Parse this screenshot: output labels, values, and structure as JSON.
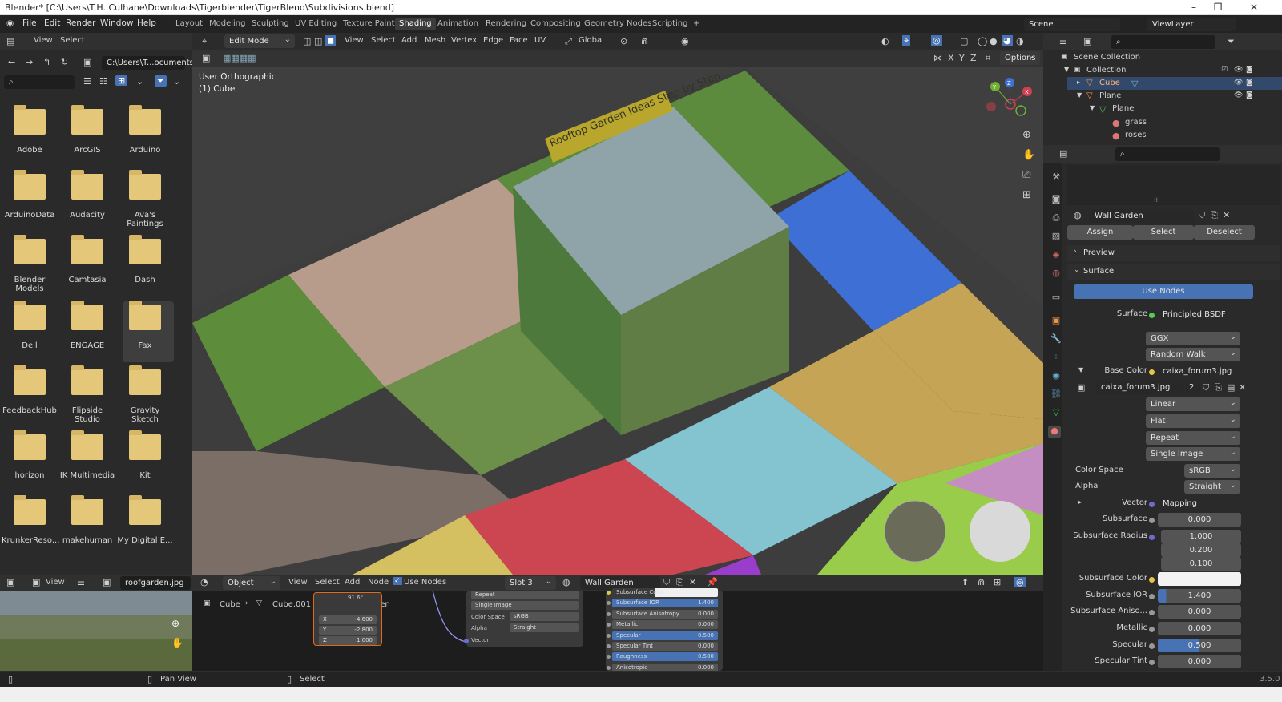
{
  "window": {
    "title": "Blender* [C:\\Users\\T.H. Culhane\\Downloads\\Tigerblender\\TigerBlend\\Subdivisions.blend]",
    "minimize": "–",
    "restore": "❐",
    "close": "✕"
  },
  "menu": [
    "File",
    "Edit",
    "Render",
    "Window",
    "Help"
  ],
  "workspaces": [
    "Layout",
    "Modeling",
    "Sculpting",
    "UV Editing",
    "Texture Paint",
    "Shading",
    "Animation",
    "Rendering",
    "Compositing",
    "Geometry Nodes",
    "Scripting",
    "+"
  ],
  "scene": {
    "label": "Scene",
    "viewlayer": "ViewLayer"
  },
  "filebrowser": {
    "view": "View",
    "select": "Select",
    "path": "C:\\Users\\T...ocuments\\",
    "items": [
      "Adobe",
      "ArcGIS",
      "Arduino",
      "ArduinoData",
      "Audacity",
      "Ava's Paintings",
      "Blender Models",
      "Camtasia",
      "Dash",
      "Dell",
      "ENGAGE",
      "Fax",
      "FeedbackHub",
      "Flipside Studio",
      "Gravity Sketch",
      "horizon",
      "IK Multimedia",
      "Kit",
      "KrunkerReso...",
      "makehuman",
      "My Digital E..."
    ]
  },
  "viewport": {
    "mode": "Edit Mode",
    "menus": [
      "View",
      "Select",
      "Add",
      "Mesh",
      "Vertex",
      "Edge",
      "Face",
      "UV"
    ],
    "transform": "Global",
    "options": "Options",
    "view_name": "User Orthographic",
    "object": "(1) Cube",
    "banner": "Rooftop Garden Ideas Step by Step",
    "axes": {
      "x": "X",
      "y": "Y",
      "z": "Z"
    },
    "xyz": [
      "X",
      "Y",
      "Z"
    ]
  },
  "outliner": {
    "root": "Scene Collection",
    "collection": "Collection",
    "items": [
      "Cube",
      "Plane",
      "Plane",
      "grass",
      "roses"
    ]
  },
  "properties": {
    "material": "Wall Garden",
    "assign": "Assign",
    "select": "Select",
    "deselect": "Deselect",
    "preview": "Preview",
    "surface_panel": "Surface",
    "use_nodes": "Use Nodes",
    "surface_label": "Surface",
    "surface_value": "Principled BSDF",
    "ggx": "GGX",
    "random_walk": "Random Walk",
    "base_color_label": "Base Color",
    "base_color_value": "caixa_forum3.jpg",
    "image_name": "caixa_forum3.jpg",
    "image_users": "2",
    "linear": "Linear",
    "flat": "Flat",
    "repeat": "Repeat",
    "single_image": "Single Image",
    "color_space_label": "Color Space",
    "color_space": "sRGB",
    "alpha_label": "Alpha",
    "alpha": "Straight",
    "vector_label": "Vector",
    "vector": "Mapping",
    "subsurface_label": "Subsurface",
    "subsurface": "0.000",
    "subsurface_radius_label": "Subsurface Radius",
    "radius": [
      "1.000",
      "0.200",
      "0.100"
    ],
    "subsurface_color_label": "Subsurface Color",
    "subsurface_ior_label": "Subsurface IOR",
    "subsurface_ior": "1.400",
    "subsurface_aniso_label": "Subsurface Aniso...",
    "subsurface_aniso": "0.000",
    "metallic_label": "Metallic",
    "metallic": "0.000",
    "specular_label": "Specular",
    "specular": "0.500",
    "specular_tint_label": "Specular Tint",
    "specular_tint": "0.000"
  },
  "image_editor": {
    "view": "View",
    "image": "roofgarden.jpg"
  },
  "node_editor": {
    "object": "Object",
    "menus": [
      "View",
      "Select",
      "Add",
      "Node"
    ],
    "use_nodes": "Use Nodes",
    "slot": "Slot 3",
    "material": "Wall Garden",
    "breadcrumb": [
      "Cube",
      "Cube.001",
      "Wall Garden"
    ],
    "mapping": {
      "angle": "91.6°",
      "x": "-4.600",
      "y": "-2.800",
      "z": "1.000",
      "xl": "X",
      "yl": "Y",
      "zl": "Z"
    },
    "image_node": {
      "repeat": "Repeat",
      "single": "Single Image",
      "cs_label": "Color Space",
      "cs": "sRGB",
      "alpha_label": "Alpha",
      "alpha": "Straight",
      "vector": "Vector"
    },
    "bsdf": [
      [
        "Subsurface Color",
        ""
      ],
      [
        "Subsurface IOR",
        "1.400"
      ],
      [
        "Subsurface Anisotropy",
        "0.000"
      ],
      [
        "Metallic",
        "0.000"
      ],
      [
        "Specular",
        "0.500"
      ],
      [
        "Specular Tint",
        "0.000"
      ],
      [
        "Roughness",
        "0.500"
      ],
      [
        "Anisotropic",
        "0.000"
      ]
    ]
  },
  "status": {
    "pan": "Pan View",
    "select": "Select",
    "version": "3.5.0"
  },
  "colors": {
    "accent": "#4772b3",
    "header": "#303030",
    "panel": "#2a2a2a",
    "folder": "#e5c77a"
  }
}
